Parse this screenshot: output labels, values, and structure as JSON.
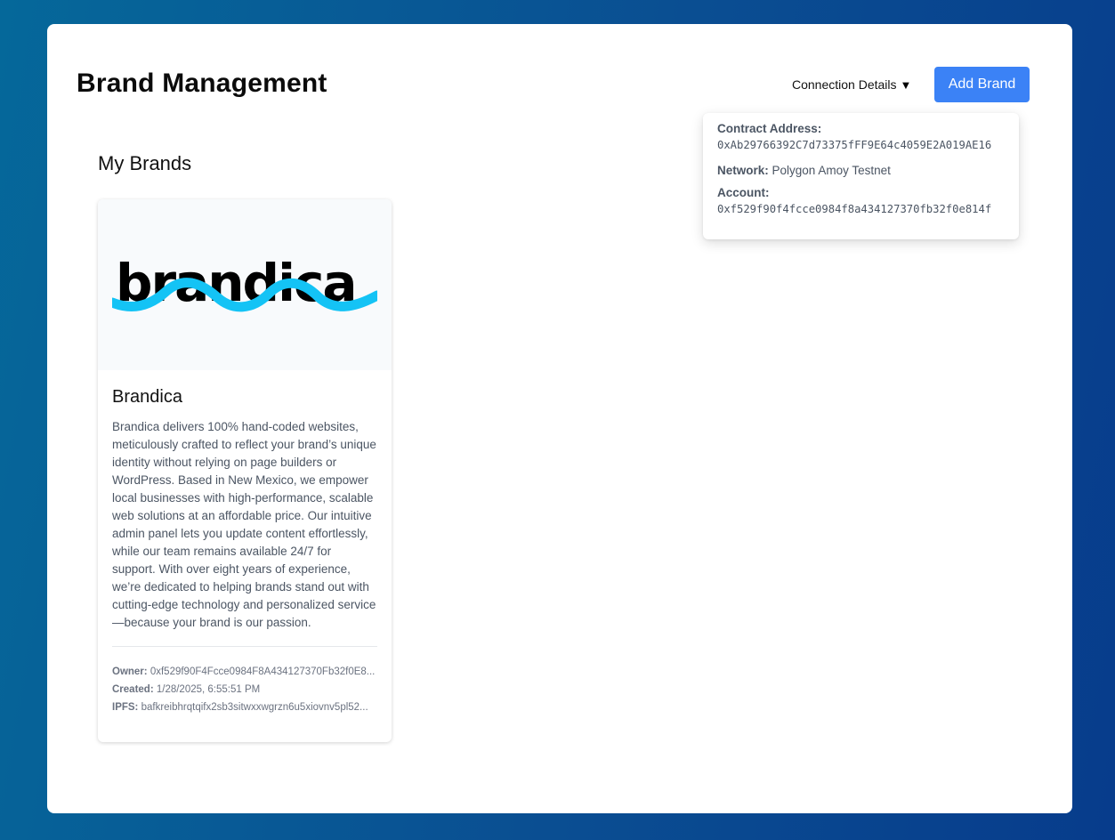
{
  "header": {
    "title": "Brand Management",
    "connection_toggle_label": "Connection Details",
    "connection_toggle_caret": "▼",
    "add_button_label": "Add Brand"
  },
  "connection": {
    "contract_label": "Contract Address:",
    "contract_value": "0xAb29766392C7d73375fFF9E64c4059E2A019AE16",
    "network_label": "Network:",
    "network_value": "Polygon Amoy Testnet",
    "account_label": "Account:",
    "account_value": "0xf529f90f4fcce0984f8a434127370fb32f0e814f"
  },
  "brands_section": {
    "title": "My Brands",
    "brands": [
      {
        "logo_text": "brandica",
        "name": "Brandica",
        "description": "Brandica delivers 100% hand-coded websites, meticulously crafted to reflect your brand’s unique identity without relying on page builders or WordPress. Based in New Mexico, we empower local businesses with high-performance, scalable web solutions at an affordable price. Our intuitive admin panel lets you update content effortlessly, while our team remains available 24/7 for support. With over eight years of experience, we’re dedicated to helping brands stand out with cutting-edge technology and personalized service—because your brand is our passion.",
        "owner_label": "Owner:",
        "owner_value": "0xf529f90F4Fcce0984F8A434127370Fb32f0E8...",
        "created_label": "Created:",
        "created_value": "1/28/2025, 6:55:51 PM",
        "ipfs_label": "IPFS:",
        "ipfs_value": "bafkreibhrqtqifx2sb3sitwxxwgrzn6u5xiovnv5pl52..."
      }
    ]
  },
  "colors": {
    "accent": "#3b82f6",
    "logo_wave": "#14c3f5",
    "background_start": "#05689a",
    "background_end": "#073c8c"
  }
}
